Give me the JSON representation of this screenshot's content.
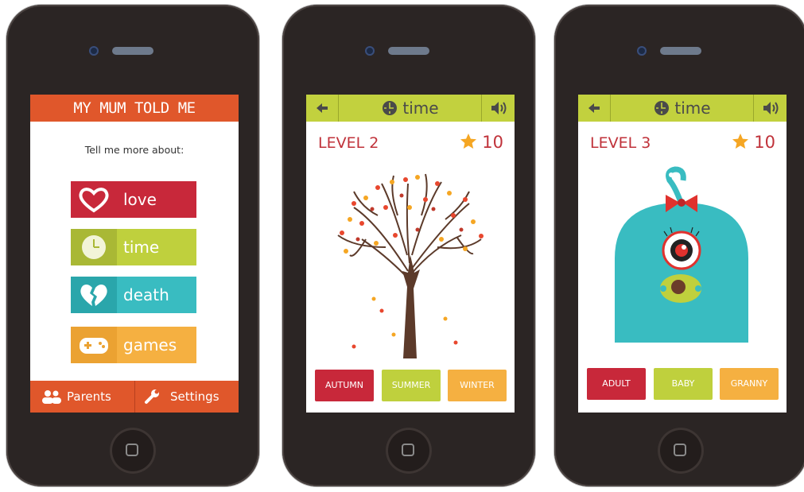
{
  "colors": {
    "red": "#c8283a",
    "green": "#bfd03d",
    "teal": "#39bcc1",
    "orange": "#f5b041",
    "header_orange": "#e0572b"
  },
  "screen1": {
    "app_title": "MY MUM TOLD ME",
    "prompt": "Tell me more about:",
    "categories": [
      {
        "label": "love",
        "icon": "heart-icon",
        "color": "#c8283a"
      },
      {
        "label": "time",
        "icon": "clock-icon",
        "color": "#bfd03d"
      },
      {
        "label": "death",
        "icon": "broken-heart-icon",
        "color": "#39bcc1"
      },
      {
        "label": "games",
        "icon": "gamepad-icon",
        "color": "#f5b041"
      }
    ],
    "bottom": {
      "parents": "Parents",
      "settings": "Settings"
    }
  },
  "screen2": {
    "title": "time",
    "level": "LEVEL 2",
    "score": "10",
    "answers": [
      "AUTUMN",
      "SUMMER",
      "WINTER"
    ]
  },
  "screen3": {
    "title": "time",
    "level": "LEVEL 3",
    "score": "10",
    "answers": [
      "ADULT",
      "BABY",
      "GRANNY"
    ]
  }
}
